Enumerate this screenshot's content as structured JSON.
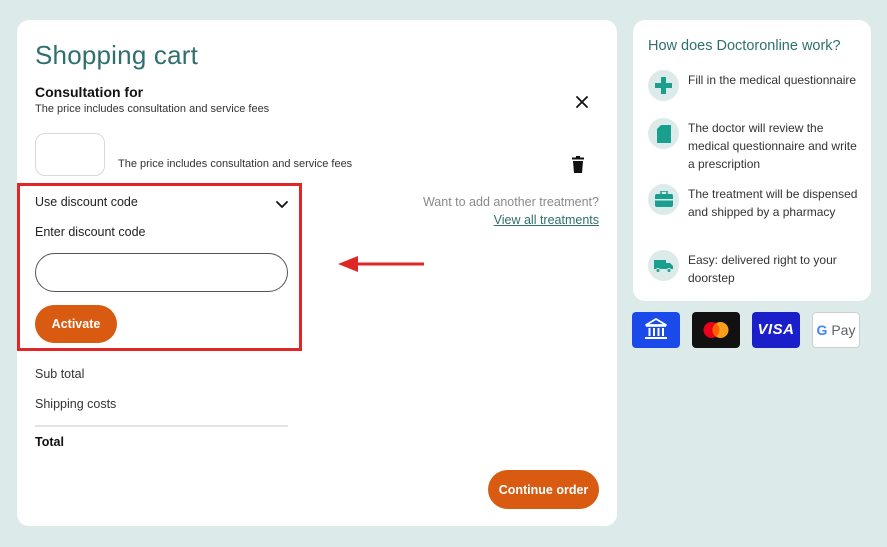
{
  "cart": {
    "title": "Shopping cart",
    "consultation_title": "Consultation for",
    "consultation_subtitle": "The price includes consultation and service fees",
    "product_note": "The price includes consultation and service fees",
    "discount": {
      "toggle_label": "Use discount code",
      "field_label": "Enter discount code",
      "input_value": "",
      "activate_label": "Activate"
    },
    "another_treatment_text": "Want to add another treatment?",
    "view_all_link": "View all treatments",
    "subtotal_label": "Sub total",
    "shipping_label": "Shipping costs",
    "total_label": "Total",
    "continue_label": "Continue order"
  },
  "how": {
    "title": "How does Doctoronline work?",
    "steps": [
      {
        "icon": "medical-cross-icon",
        "text": "Fill in the medical questionnaire"
      },
      {
        "icon": "document-icon",
        "text": "The doctor will review the medical questionnaire and write a prescription"
      },
      {
        "icon": "medical-bag-icon",
        "text": "The treatment will be dispensed and shipped by a pharmacy"
      },
      {
        "icon": "delivery-truck-icon",
        "text": "Easy: delivered right to your doorstep"
      }
    ]
  },
  "payment": {
    "methods": [
      {
        "icon": "bank-icon"
      },
      {
        "icon": "mastercard-icon"
      },
      {
        "icon": "visa-icon",
        "label": "VISA"
      },
      {
        "icon": "google-pay-icon",
        "label": "Pay",
        "letter": "G"
      }
    ]
  },
  "colors": {
    "background": "#dcebea",
    "brand_teal": "#2f6f6f",
    "accent_orange": "#d95b12",
    "highlight_red": "#e02626",
    "icon_green": "#1a9f8f"
  }
}
